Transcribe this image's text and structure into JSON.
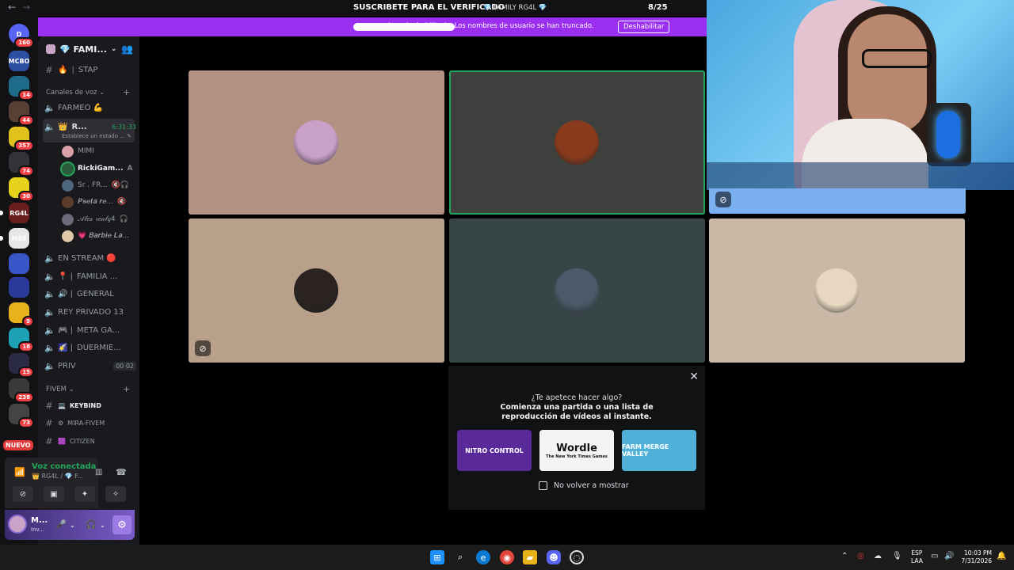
{
  "topbar": {
    "back": "←",
    "forward": "→",
    "promo": "SUSCRIBETE PARA EL VERIFICADO",
    "title": "FAMILY RG4L",
    "counter": "8/25"
  },
  "banner": {
    "text": "...uario se ha habilitado. Los nombres de usuario se han truncado.",
    "button": "Deshabilitar"
  },
  "rail": {
    "servers": [
      {
        "label": "D",
        "badge": "160",
        "color": "#5865f2"
      },
      {
        "label": "MCBO",
        "badge": "",
        "color": "#2c4fa3"
      },
      {
        "label": "",
        "badge": "14",
        "color": "#1f6c8a"
      },
      {
        "label": "",
        "badge": "44",
        "color": "#5a4034"
      },
      {
        "label": "",
        "badge": "357",
        "color": "#e0c21c"
      },
      {
        "label": "",
        "badge": "74",
        "color": "#333338"
      },
      {
        "label": "",
        "badge": "30",
        "color": "#e6d21b"
      },
      {
        "label": "RG4L",
        "badge": "",
        "color": "#6a1d1d"
      },
      {
        "label": "MSS",
        "badge": "",
        "color": "#e6e6e6"
      },
      {
        "label": "",
        "badge": "",
        "color": "#3a55c7"
      },
      {
        "label": "",
        "badge": "",
        "color": "#2a3a9a"
      },
      {
        "label": "",
        "badge": "9",
        "color": "#e8b21a"
      },
      {
        "label": "",
        "badge": "18",
        "color": "#1ea0b5"
      },
      {
        "label": "",
        "badge": "15",
        "color": "#2b2b45"
      },
      {
        "label": "",
        "badge": "238",
        "color": "#3a3a3a"
      },
      {
        "label": "",
        "badge": "73",
        "color": "#444"
      }
    ],
    "new_badge": "NUEVO"
  },
  "sidebar": {
    "guild_name": "💎 FAMI...",
    "channels_top": [
      {
        "name": "STAP",
        "icon": "#",
        "emoji": "🔥"
      }
    ],
    "voice_category": "Canales de voz",
    "voice_channels": [
      {
        "name": "FARMEO 💪",
        "bold": false
      },
      {
        "name": "R...",
        "bold": true,
        "timer": "6:31:33",
        "status": "Establece un estado ..."
      },
      {
        "name": "EN STREAM 🔴",
        "bold": false
      },
      {
        "name": "FAMILIA ...",
        "bold": false,
        "emoji": "📍"
      },
      {
        "name": "GENERAL",
        "bold": false,
        "emoji": "🔊"
      },
      {
        "name": "REY PRIVADO 13",
        "bold": false
      },
      {
        "name": "META GA...",
        "bold": false,
        "emoji": "🎮"
      },
      {
        "name": "DUERMIE...",
        "bold": false,
        "emoji": "🌠"
      },
      {
        "name": "PRIV",
        "bold": false,
        "counts": "00 02"
      }
    ],
    "users": [
      {
        "name": "MIMI",
        "color": "#d9a0a8",
        "icons": ""
      },
      {
        "name": "RickiGam...",
        "color": "#2a5b3a",
        "icons": "A",
        "bold": true
      },
      {
        "name": "Sr . FR...",
        "color": "#4b6780",
        "icons": "🔇🎧"
      },
      {
        "name": "𝑷𝒔𝒆𝒕𝒂 𝒓𝒆...",
        "color": "#5c3c2a",
        "icons": "🔇"
      },
      {
        "name": "𝒜𝓁𝑒𝓍 𝓇𝑒𝒶𝓁𝑔4",
        "color": "#6a6a7a",
        "icons": "🎧"
      },
      {
        "name": "💗 𝑩𝒂𝒓𝒃𝒊𝒆 𝑳𝒂...",
        "color": "#e2c8a8",
        "icons": ""
      }
    ],
    "fivem_category": "FIVEM",
    "fivem_channels": [
      {
        "name": "KEYBIND",
        "emoji": "💻"
      },
      {
        "name": "MIRA-FIVEM",
        "emoji": "⚙"
      },
      {
        "name": "CITIZEN",
        "emoji": "🟪"
      }
    ]
  },
  "voice_panel": {
    "title": "Voz conectada",
    "subtitle": "👑 RG4L / 💎 F..."
  },
  "user_panel": {
    "name": "M...",
    "status": "Inv..."
  },
  "tiles": [
    {
      "bg": "#b39183",
      "avatar": "#c9a0c8",
      "speaking": false,
      "muted": false
    },
    {
      "bg": "#3d403c",
      "avatar": "#8a3a1c",
      "speaking": true,
      "muted": false
    },
    {
      "bg": "#b8a08a",
      "avatar": "#2a2322",
      "speaking": false,
      "muted": true
    },
    {
      "bg": "#384547",
      "avatar": "#4a5a6a",
      "speaking": false,
      "muted": false
    },
    {
      "bg": "#c9b8a6",
      "avatar": "#e8d7c0",
      "speaking": false,
      "muted": false
    }
  ],
  "popup": {
    "title": "¿Te apetece hacer algo?",
    "subtitle": "Comienza una partida o una lista de reproducción de vídeos al instante.",
    "cards": [
      {
        "label": "NITRO CONTROL",
        "sub": "",
        "bg": "#5b2a9a",
        "fg": "#ffffff"
      },
      {
        "label": "Wordle",
        "sub": "The New York Times Games",
        "bg": "#f4f4f4",
        "fg": "#111111"
      },
      {
        "label": "FARM MERGE VALLEY",
        "sub": "",
        "bg": "#4fb0d8",
        "fg": "#ffffff"
      }
    ],
    "checkbox_label": "No volver a mostrar"
  },
  "taskbar": {
    "lang_top": "ESP",
    "lang_bottom": "LAA",
    "time": "10:03 PM",
    "date": "7/31/2026"
  }
}
